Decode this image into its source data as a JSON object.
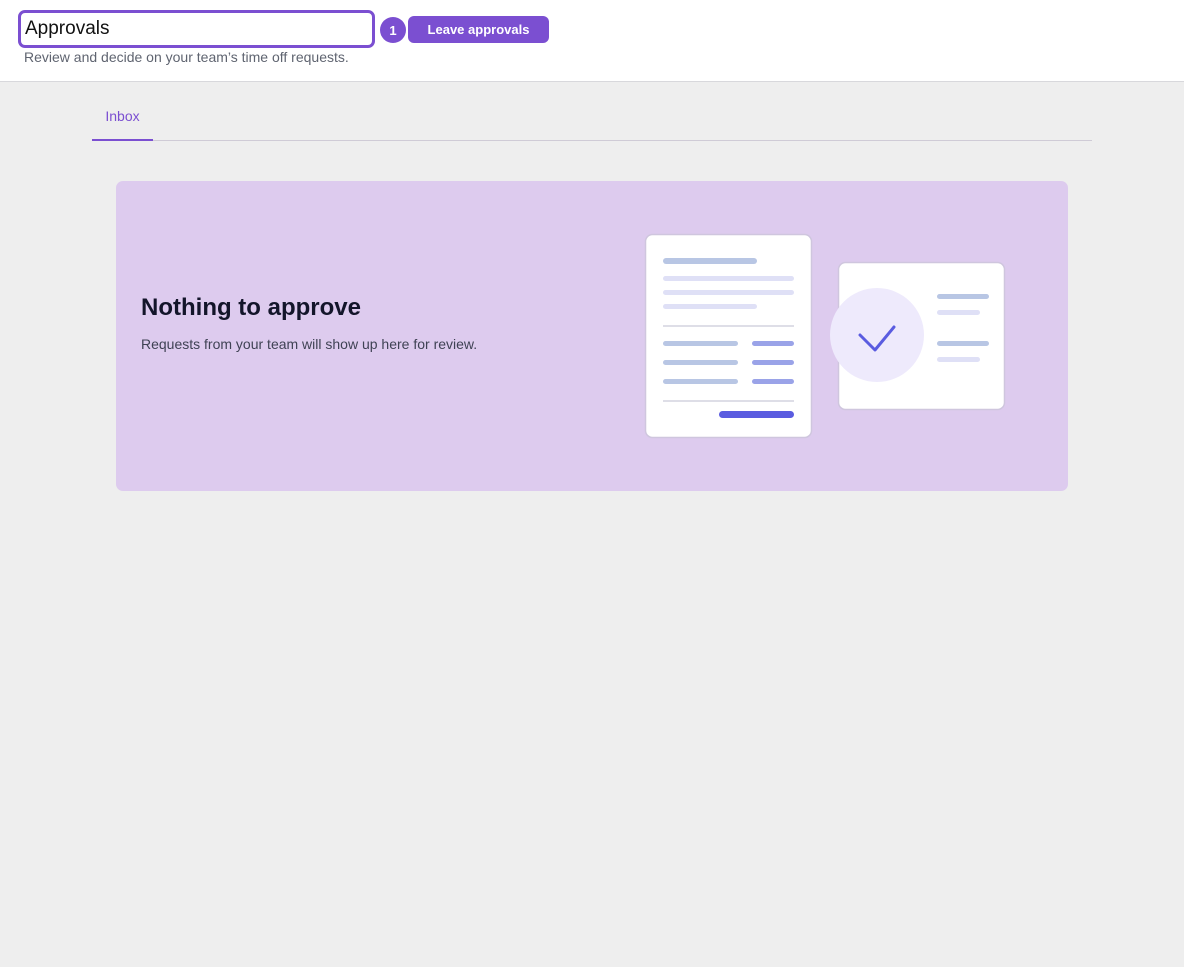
{
  "header": {
    "title_value": "Approvals",
    "badge_count": "1",
    "button_label": "Leave approvals",
    "subtitle": "Review and decide on your team’s time off requests."
  },
  "tabs": [
    {
      "label": "Inbox",
      "active": true
    }
  ],
  "empty_state": {
    "title": "Nothing to approve",
    "description": "Requests from your team will show up here for review.",
    "illustration": "document-and-checkmark-icon"
  },
  "colors": {
    "accent": "#7b4fd1",
    "card_background": "#ddcbee",
    "page_background": "#eeeeee"
  }
}
